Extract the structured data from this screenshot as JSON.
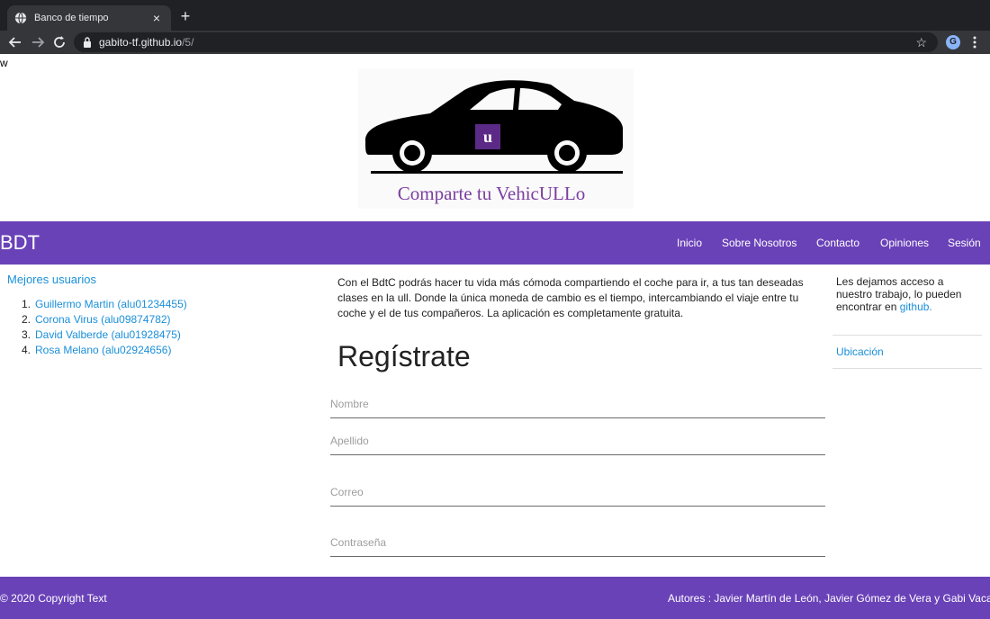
{
  "browser": {
    "tab_title": "Banco de tiempo",
    "tab_close": "×",
    "new_tab": "+",
    "url_host": "gabito-tf.github.io",
    "url_path": "/5/",
    "star": "☆",
    "profile_initial": "G",
    "icons": [
      "globe-icon",
      "back-arrow-icon",
      "forward-arrow-icon",
      "reload-icon",
      "lock-icon",
      "star-icon",
      "menu-dots-icon"
    ]
  },
  "page": {
    "stray_text": "w",
    "logo_caption": "Comparte tu VehicULLo",
    "logo_badge": "u",
    "brand": "BDT",
    "nav": [
      "Inicio",
      "Sobre Nosotros",
      "Contacto",
      "Opiniones",
      "Sesión"
    ],
    "best_users": {
      "title": "Mejores usuarios",
      "items": [
        {
          "num": "1.",
          "name": "Guillermo Martin (alu01234455)"
        },
        {
          "num": "2.",
          "name": "Corona Virus (alu09874782)"
        },
        {
          "num": "3.",
          "name": "David Valberde (alu01928475)"
        },
        {
          "num": "4.",
          "name": "Rosa Melano (alu02924656)"
        }
      ]
    },
    "intro": "Con el BdtC podrás hacer tu vida más cómoda compartiendo el coche para ir, a tus tan deseadas clases en la ull. Donde la única moneda de cambio es el tiempo, intercambiando el viaje entre tu coche y el de tus compañeros. La aplicación es completamente gratuita.",
    "register": {
      "title": "Regístrate",
      "fields": [
        "Nombre",
        "Apellido",
        "Correo",
        "Contraseña"
      ]
    },
    "sidebar": {
      "text": "Les dejamos acceso a nuestro trabajo, lo pueden encontrar en ",
      "link": "github.",
      "location": "Ubicación"
    },
    "footer": {
      "left": "© 2020 Copyright Text",
      "right": "Autores : Javier Martín de León, Javier Gómez de Vera y Gabi Vacaru"
    }
  },
  "colors": {
    "purple": "#6a42b8",
    "link_blue": "#1a8fd9",
    "chrome_dark": "#202124"
  }
}
